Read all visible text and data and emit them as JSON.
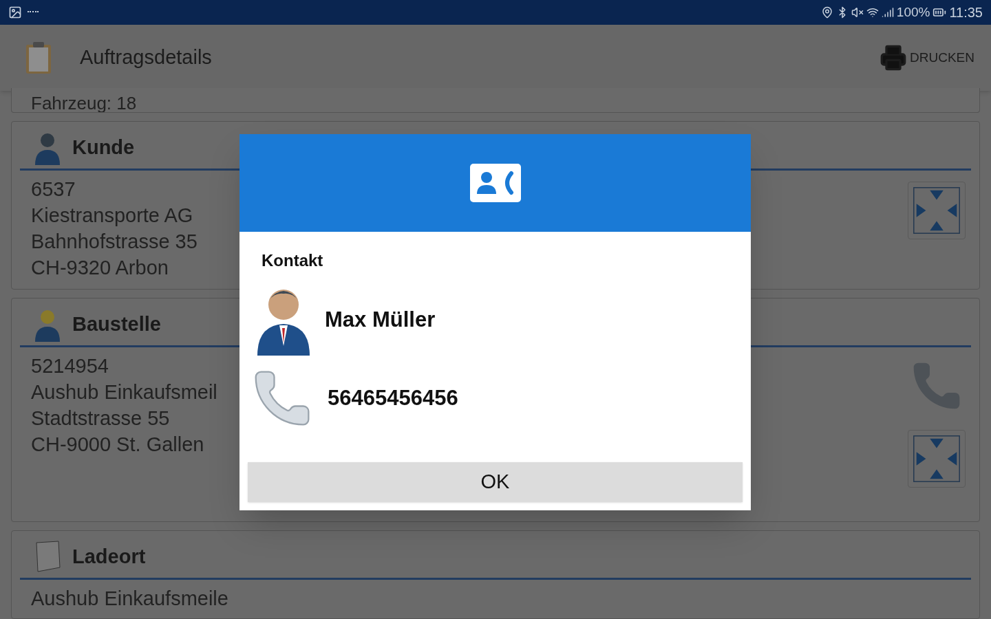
{
  "status_bar": {
    "battery": "100%",
    "time": "11:35"
  },
  "app_bar": {
    "title": "Auftragsdetails",
    "print_button": "DRUCKEN"
  },
  "sections": [
    {
      "kind": "partial",
      "lines": [
        "Fahrzeug: 18"
      ]
    },
    {
      "kind": "customer",
      "title": "Kunde",
      "lines": [
        "6537",
        "Kiestransporte AG",
        "Bahnhofstrasse 35",
        "CH-9320 Arbon"
      ],
      "actions": [
        {
          "kind": "expand"
        }
      ]
    },
    {
      "kind": "site",
      "title": "Baustelle",
      "lines": [
        "5214954",
        "Aushub Einkaufsmeil",
        "Stadtstrasse 55",
        "CH-9000 St. Gallen"
      ],
      "actions": [
        {
          "kind": "phone"
        },
        {
          "kind": "expand"
        }
      ]
    },
    {
      "kind": "loading",
      "title": "Ladeort",
      "lines": [
        "Aushub Einkaufsmeile"
      ]
    }
  ],
  "dialog": {
    "title": "Kontakt",
    "name": "Max Müller",
    "phone": "56465456456",
    "button": "OK"
  }
}
